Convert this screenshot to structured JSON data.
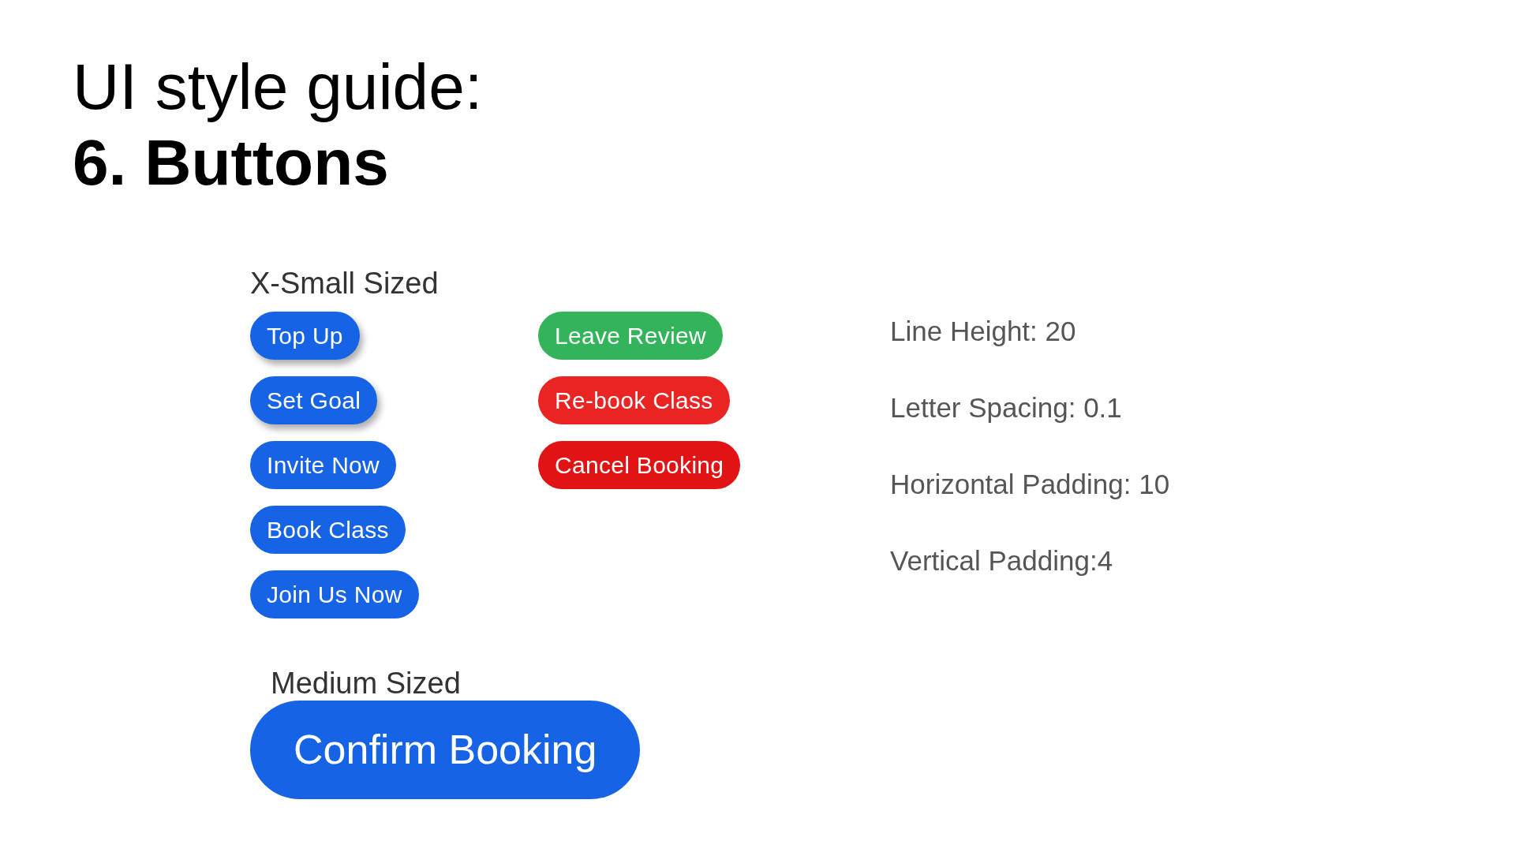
{
  "title": {
    "line_1": "UI style guide:",
    "line_2": "6. Buttons"
  },
  "x_small": {
    "label": "X-Small Sized",
    "columns": [
      {
        "buttons": [
          {
            "label": "Top Up",
            "color": "#1763e6",
            "shadow": true
          },
          {
            "label": "Set Goal",
            "color": "#1763e6",
            "shadow": true
          },
          {
            "label": "Invite Now",
            "color": "#1763e6",
            "shadow": false
          },
          {
            "label": "Book Class",
            "color": "#1763e6",
            "shadow": false
          },
          {
            "label": "Join Us Now",
            "color": "#1763e6",
            "shadow": false
          }
        ]
      },
      {
        "buttons": [
          {
            "label": "Leave Review",
            "color": "#34b45a",
            "shadow": false
          },
          {
            "label": "Re-book Class",
            "color": "#ea2323",
            "shadow": false
          },
          {
            "label": "Cancel Booking",
            "color": "#e01414",
            "shadow": false
          }
        ]
      }
    ],
    "specs": [
      "Line Height: 20",
      "Letter Spacing: 0.1",
      "Horizontal Padding: 10",
      "Vertical Padding:4"
    ]
  },
  "medium": {
    "label": "Medium Sized",
    "buttons": [
      {
        "label": "Confirm Booking",
        "color": "#1763e6"
      }
    ]
  }
}
